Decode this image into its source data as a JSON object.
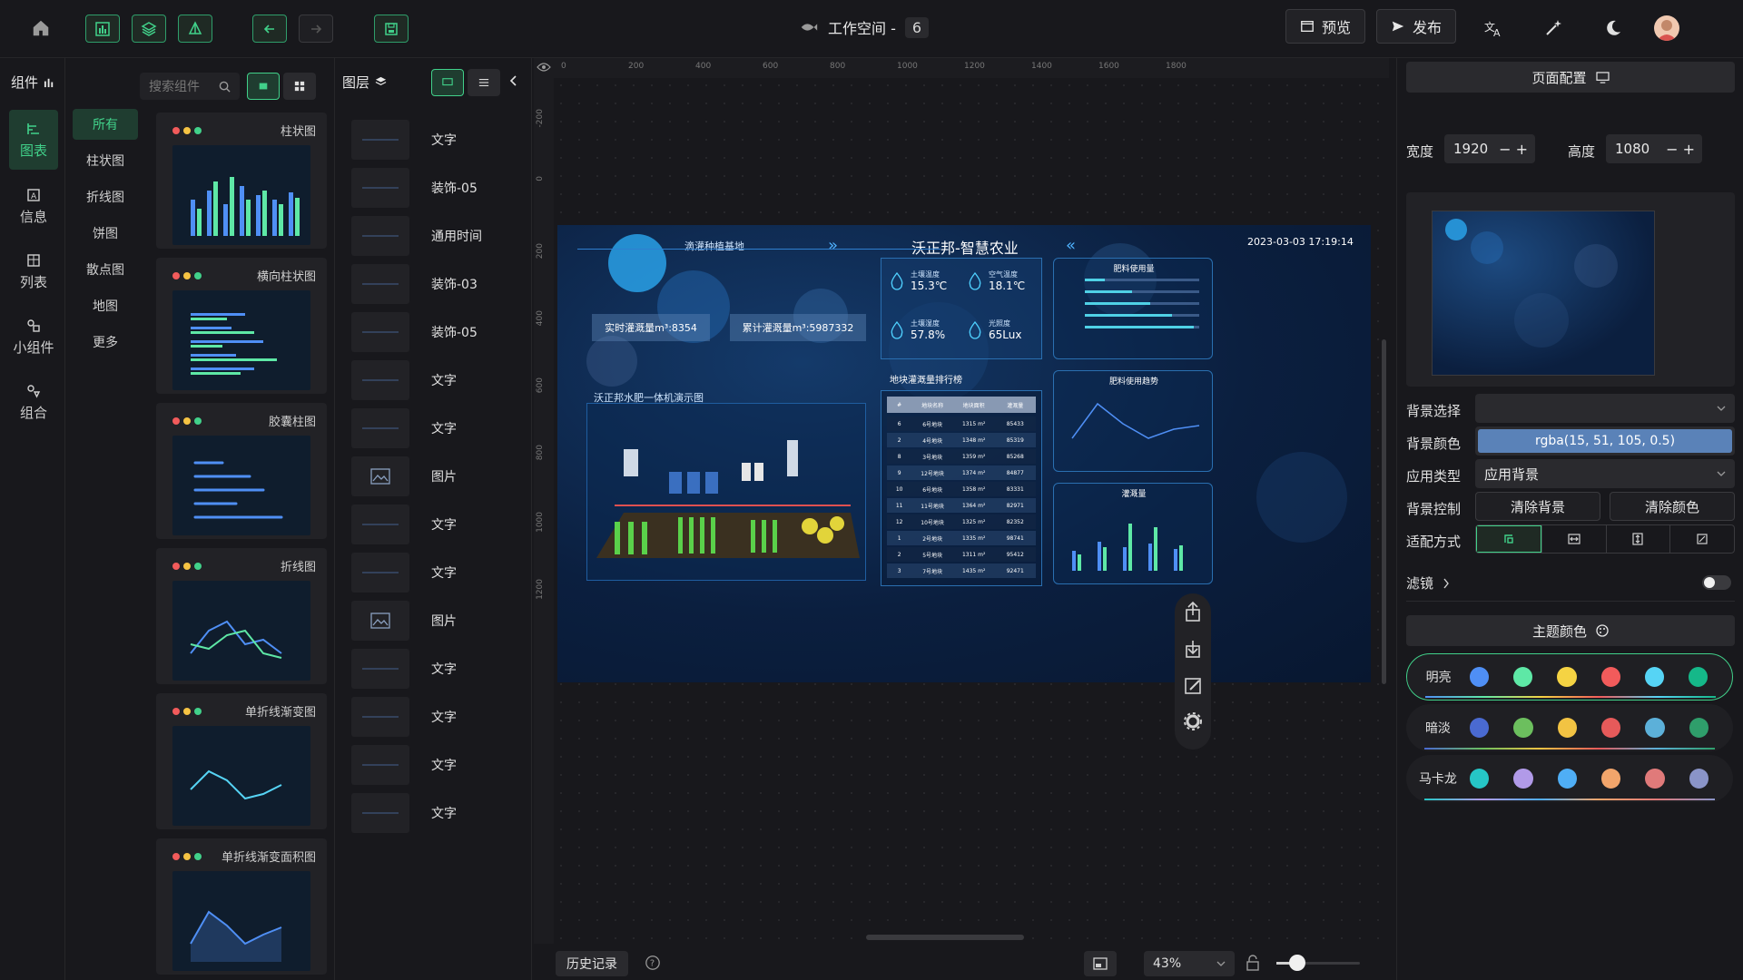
{
  "topbar": {
    "workspace_label": "工作空间 -",
    "workspace_num": "6",
    "preview_label": "预览",
    "publish_label": "发布"
  },
  "components_panel": {
    "title": "组件",
    "search_placeholder": "搜索组件"
  },
  "left_nav": [
    {
      "label": "图表"
    },
    {
      "label": "信息"
    },
    {
      "label": "列表"
    },
    {
      "label": "小组件"
    },
    {
      "label": "组合"
    }
  ],
  "categories": [
    "所有",
    "柱状图",
    "折线图",
    "饼图",
    "散点图",
    "地图",
    "更多"
  ],
  "widgets": [
    {
      "title": "柱状图"
    },
    {
      "title": "横向柱状图"
    },
    {
      "title": "胶囊柱图"
    },
    {
      "title": "折线图"
    },
    {
      "title": "单折线渐变图"
    },
    {
      "title": "单折线渐变面积图"
    }
  ],
  "layers_panel": {
    "title": "图层",
    "items": [
      "文字",
      "装饰-05",
      "通用时间",
      "装饰-03",
      "装饰-05",
      "文字",
      "文字",
      "图片",
      "文字",
      "文字",
      "图片",
      "文字",
      "文字",
      "文字",
      "文字"
    ]
  },
  "ruler": {
    "h": [
      "0",
      "200",
      "400",
      "600",
      "800",
      "1000",
      "1200",
      "1400",
      "1600",
      "1800"
    ],
    "v": [
      "-200",
      "0",
      "200",
      "400",
      "600",
      "800",
      "1000",
      "1200"
    ]
  },
  "dashboard": {
    "title": "沃正邦-智慧农业",
    "datetime": "2023-03-03 17:19:14",
    "subtitle_left": "滴灌种植基地",
    "realtime": "实时灌溉量m³:8354",
    "cumulative": "累计灌溉量m³:5987332",
    "diagram_title": "沃正邦水肥一体机演示图",
    "sensors": [
      {
        "name": "土壤温度",
        "value": "15.3℃"
      },
      {
        "name": "空气温度",
        "value": "18.1℃"
      },
      {
        "name": "土壤湿度",
        "value": "57.8%"
      },
      {
        "name": "光照度",
        "value": "65Lux"
      }
    ],
    "fert_title": "肥料使用量",
    "trend_title": "肥料使用趋势",
    "irrig_title": "灌溉量",
    "rank_title": "地块灌溉量排行榜",
    "rank_headers": [
      "#",
      "地块名称",
      "地块面积",
      "灌溉量"
    ],
    "rank_rows": [
      [
        "6",
        "6号地块",
        "1315 m²",
        "85433"
      ],
      [
        "2",
        "4号地块",
        "1348 m²",
        "85319"
      ],
      [
        "8",
        "3号地块",
        "1359 m²",
        "85268"
      ],
      [
        "9",
        "12号地块",
        "1374 m²",
        "84877"
      ],
      [
        "10",
        "6号地块",
        "1358 m²",
        "83331"
      ],
      [
        "11",
        "11号地块",
        "1364 m²",
        "82971"
      ],
      [
        "12",
        "10号地块",
        "1325 m²",
        "82352"
      ],
      [
        "1",
        "2号地块",
        "1335 m²",
        "98741"
      ],
      [
        "2",
        "5号地块",
        "1311 m²",
        "95412"
      ],
      [
        "3",
        "7号地块",
        "1435 m²",
        "92471"
      ]
    ]
  },
  "bottombar": {
    "history_label": "历史记录",
    "zoom": "43%"
  },
  "right": {
    "page_config": "页面配置",
    "width_label": "宽度",
    "width_value": "1920",
    "height_label": "高度",
    "height_value": "1080",
    "bg_select_label": "背景选择",
    "bg_color_label": "背景颜色",
    "bg_color_value": "rgba(15, 51, 105, 0.5)",
    "apply_type_label": "应用类型",
    "apply_type_value": "应用背景",
    "bg_control_label": "背景控制",
    "clear_bg": "清除背景",
    "clear_color": "清除颜色",
    "fit_label": "适配方式",
    "filter_label": "滤镜",
    "theme_color": "主题颜色",
    "themes": [
      {
        "name": "明亮",
        "colors": [
          "#4f8ff5",
          "#5ee8a6",
          "#f5d343",
          "#f25b5b",
          "#56d4f5",
          "#15b889"
        ]
      },
      {
        "name": "暗淡",
        "colors": [
          "#4a6ad1",
          "#6cbf5e",
          "#f2c343",
          "#e65a5a",
          "#5cb0d9",
          "#2f9e6b"
        ]
      },
      {
        "name": "马卡龙",
        "colors": [
          "#26c6c6",
          "#b19ae8",
          "#4faef5",
          "#f2a56b",
          "#e07a7a",
          "#8a94c8"
        ]
      }
    ]
  },
  "colors": {
    "accent": "#41d18a",
    "panel": "#18181c",
    "card": "#222226"
  }
}
